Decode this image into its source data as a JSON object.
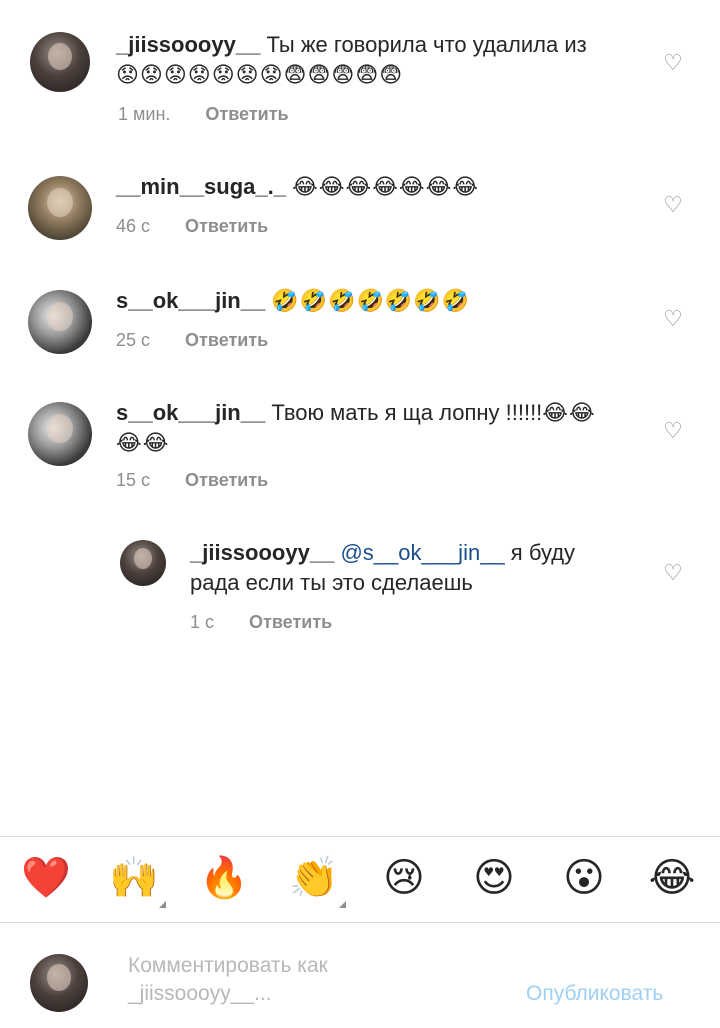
{
  "comments": [
    {
      "username": "_jiissoooyy__",
      "text": "Ты же говорила что удалила из",
      "emoji": "😟😟😟😟😟😟😟😨😨😨😨😨",
      "time": "1 мин.",
      "reply_label": "Ответить",
      "avatar_icon": "profile-photo"
    },
    {
      "username": "__min__suga_._",
      "text": "",
      "emoji": "😂😂😂😂😂😂😂",
      "time": "46 с",
      "reply_label": "Ответить",
      "avatar_icon": "profile-photo"
    },
    {
      "username": "s__ok___jin__",
      "text": "",
      "emoji": "🤣🤣🤣🤣🤣🤣🤣",
      "time": "25 с",
      "reply_label": "Ответить",
      "avatar_icon": "profile-photo"
    },
    {
      "username": "s__ok___jin__",
      "text": "Твою мать я ща лопну !!!!!!",
      "emoji": "😂😂",
      "emoji2": "😂😂",
      "time": "15 с",
      "reply_label": "Ответить",
      "avatar_icon": "profile-photo"
    }
  ],
  "reply": {
    "username": "_jiissoooyy__",
    "mention": "@s__ok___jin__",
    "text_1": "я буду",
    "text_2": "рада если ты это сделаешь",
    "time": "1 с",
    "reply_label": "Ответить"
  },
  "reactions": [
    {
      "emoji": "❤️",
      "name": "heart"
    },
    {
      "emoji": "🙌",
      "name": "raising-hands"
    },
    {
      "emoji": "🔥",
      "name": "fire"
    },
    {
      "emoji": "👏",
      "name": "clapping-hands"
    },
    {
      "emoji": "😢",
      "name": "crying-face"
    },
    {
      "emoji": "😍",
      "name": "heart-eyes"
    },
    {
      "emoji": "😮",
      "name": "surprised-face"
    },
    {
      "emoji": "😂",
      "name": "tears-of-joy"
    }
  ],
  "composer": {
    "placeholder_line1": "Комментировать как",
    "placeholder_line2": "_jiissoooyy__...",
    "post_label": "Опубликовать"
  },
  "like_icon": "♡",
  "colors": {
    "mention": "#1b4f8c",
    "post_button": "#9fd0f4",
    "meta_gray": "#8e8e8e"
  }
}
